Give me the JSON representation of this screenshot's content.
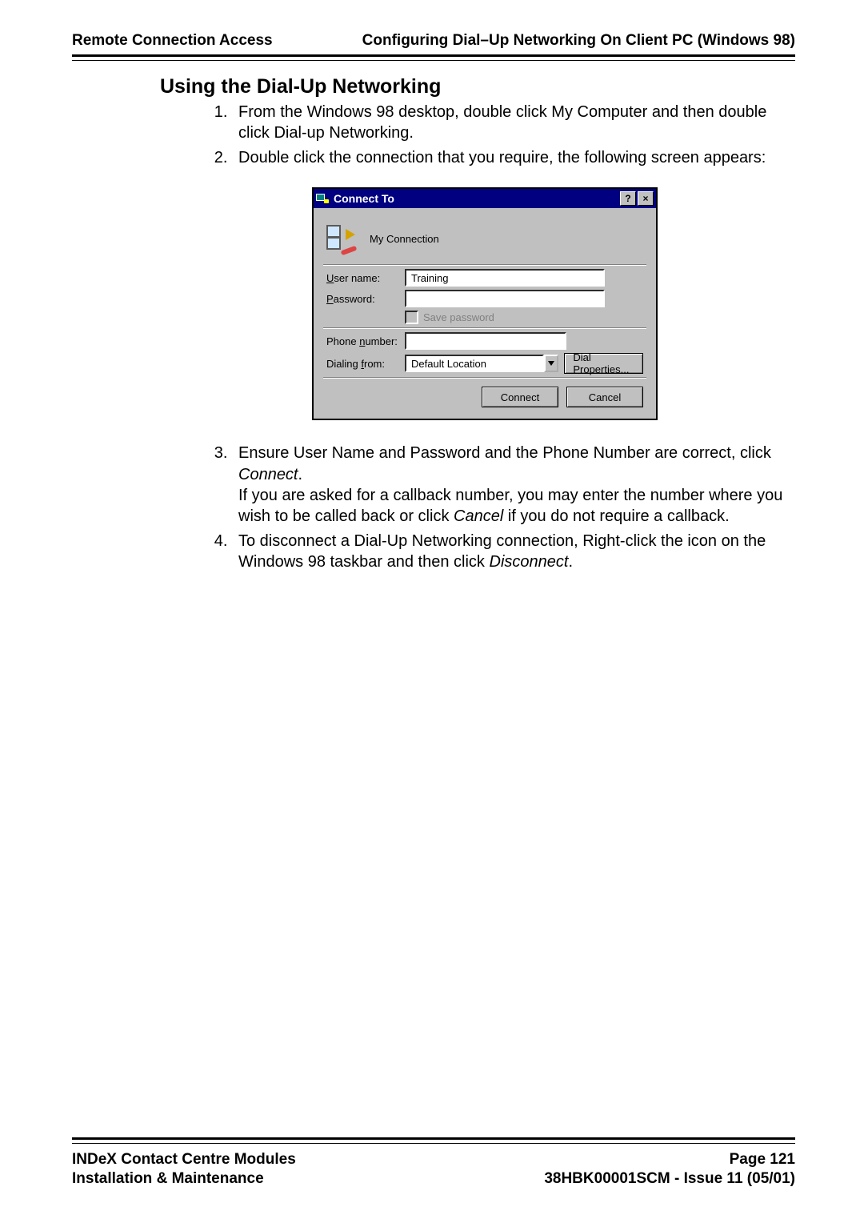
{
  "header": {
    "left": "Remote Connection Access",
    "right": "Configuring Dial–Up Networking On Client PC (Windows 98)"
  },
  "section_title": "Using the Dial-Up Networking",
  "steps": {
    "s1": "From the Windows 98 desktop, double click My Computer and then double click Dial-up Networking.",
    "s2": "Double click the connection that you require, the following screen appears:",
    "s3a": "Ensure User Name and Password and the Phone Number are correct, click ",
    "s3b_italic": "Connect",
    "s3c": ".",
    "s3d": "If you are asked for a callback number, you may enter the number where you wish to be called back or click ",
    "s3e_italic": "Cancel",
    "s3f": "  if you do not require a callback.",
    "s4a": "To disconnect a Dial-Up Networking connection, Right-click the icon on the Windows 98 taskbar and then click ",
    "s4b_italic": "Disconnect",
    "s4c": "."
  },
  "dialog": {
    "title": "Connect To",
    "help_glyph": "?",
    "close_glyph": "×",
    "name": "My Connection",
    "labels": {
      "username": "ser name:",
      "username_u": "U",
      "password": "assword:",
      "password_u": "P",
      "save_pw": "ave password",
      "save_pw_u": "S",
      "phone": "Phone ",
      "phone_u": "n",
      "phone2": "umber:",
      "dialfrom": "Dialing ",
      "dialfrom_u": "f",
      "dialfrom2": "rom:"
    },
    "fields": {
      "username": "Training",
      "password": "",
      "phone": "",
      "location": "Default Location"
    },
    "buttons": {
      "dialprops": "Dial Properties...",
      "dialprops_u": "D",
      "connect": "Connect",
      "cancel": "Cancel"
    }
  },
  "footer": {
    "left1": "INDeX Contact Centre Modules",
    "left2": "Installation & Maintenance",
    "right1": "Page 121",
    "right2": "38HBK00001SCM - Issue 11 (05/01)"
  }
}
